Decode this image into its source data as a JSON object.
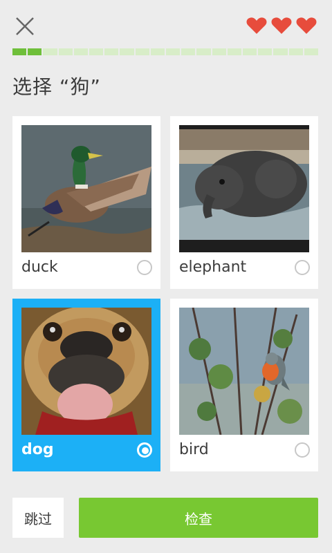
{
  "header": {
    "close_icon": "close-icon",
    "hearts": [
      "heart-icon",
      "heart-icon",
      "heart-icon"
    ],
    "heart_color": "#e74c3c"
  },
  "progress": {
    "completed": 2,
    "total": 20,
    "fill_color": "#6fbf3a",
    "track_color": "#d8edc8"
  },
  "question": {
    "prompt": "选择 “狗”"
  },
  "choices": [
    {
      "label": "duck",
      "selected": false
    },
    {
      "label": "elephant",
      "selected": false
    },
    {
      "label": "dog",
      "selected": true
    },
    {
      "label": "bird",
      "selected": false
    }
  ],
  "footer": {
    "skip_label": "跳过",
    "check_label": "检查",
    "check_color": "#78c832"
  },
  "selected_color": "#1cb0f6"
}
